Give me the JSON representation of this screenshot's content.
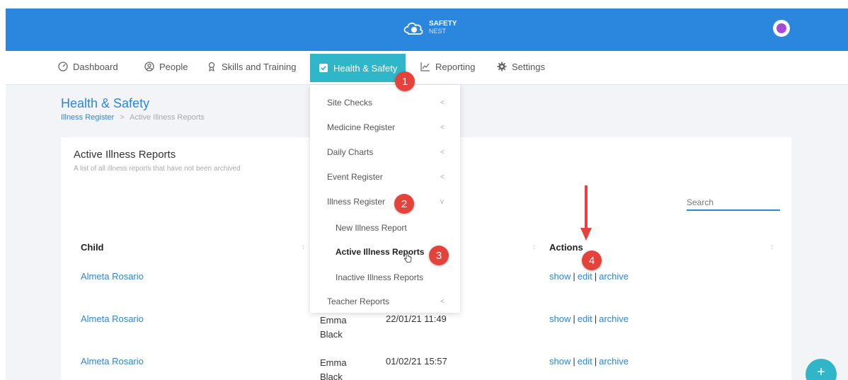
{
  "app": {
    "name": "SAFETY",
    "name_sub": "NEST"
  },
  "nav": {
    "items": [
      {
        "label": "Dashboard"
      },
      {
        "label": "People"
      },
      {
        "label": "Skills and Training"
      },
      {
        "label": "Health & Safety"
      },
      {
        "label": "Reporting"
      },
      {
        "label": "Settings"
      }
    ]
  },
  "page": {
    "title": "Health & Safety",
    "breadcrumb_link": "Illness Register",
    "breadcrumb_sep": ">",
    "breadcrumb_current": "Active Illness Reports"
  },
  "card": {
    "title": "Active Illness Reports",
    "subtitle": "A list of all illness reports that have not been archived",
    "search_placeholder": "Search"
  },
  "table": {
    "headers": {
      "child": "Child",
      "actions": "Actions"
    },
    "rows": [
      {
        "child": "Almeta Rosario",
        "staff": "",
        "date": "",
        "show": "show",
        "edit": "edit",
        "archive": "archive"
      },
      {
        "child": "Almeta Rosario",
        "staff": "Emma Black",
        "date": "22/01/21 11:49",
        "show": "show",
        "edit": "edit",
        "archive": "archive"
      },
      {
        "child": "Almeta Rosario",
        "staff": "Emma Black",
        "date": "01/02/21 15:57",
        "show": "show",
        "edit": "edit",
        "archive": "archive"
      }
    ]
  },
  "dropdown": {
    "items": [
      {
        "label": "Site Checks",
        "chev": "<"
      },
      {
        "label": "Medicine Register",
        "chev": "<"
      },
      {
        "label": "Daily Charts",
        "chev": "<"
      },
      {
        "label": "Event Register",
        "chev": "<"
      },
      {
        "label": "Illness Register",
        "chev": "v"
      },
      {
        "label": "Teacher Reports",
        "chev": "<"
      }
    ],
    "subitems": [
      {
        "label": "New Illness Report"
      },
      {
        "label": "Active Illness Reports"
      },
      {
        "label": "Inactive Illness Reports"
      }
    ]
  },
  "badges": [
    "1",
    "2",
    "3",
    "4"
  ],
  "fab": {
    "label": "+"
  },
  "colors": {
    "brand": "#2b86de",
    "active_nav": "#2fb6c9",
    "badge": "#e4433b"
  }
}
